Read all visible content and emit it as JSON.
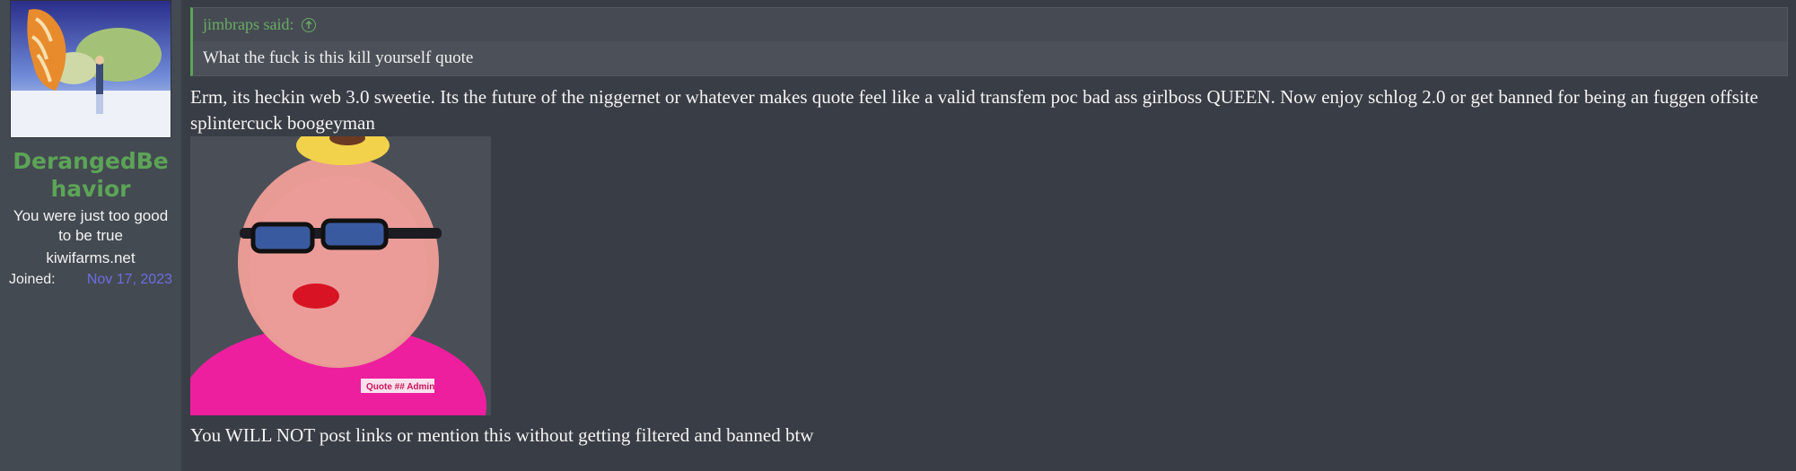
{
  "user": {
    "username": "DerangedBehavior",
    "title": "You were just too good to be true",
    "site": "kiwifarms.net",
    "joined_label": "Joined:",
    "joined_date": "Nov 17, 2023"
  },
  "quote": {
    "author_label": "jimbraps said:",
    "text": "What the fuck is this kill yourself quote",
    "jump_icon": "arrow-up-circle-icon"
  },
  "post": {
    "body": "Erm, its heckin web 3.0 sweetie. Its the future of the niggernet or whatever makes quote feel like a valid transfem poc bad ass girlboss QUEEN. Now enjoy schlog 2.0 or get banned for being an fuggen offsite splintercuck boogeyman",
    "image_badge": "Quote ## Admin",
    "footer": "You WILL NOT post links or mention this without getting filtered and banned btw"
  },
  "colors": {
    "accent_green": "#5ca456",
    "link_purple": "#6c6ee0",
    "background": "#393d45",
    "sidebar": "#444a52"
  }
}
